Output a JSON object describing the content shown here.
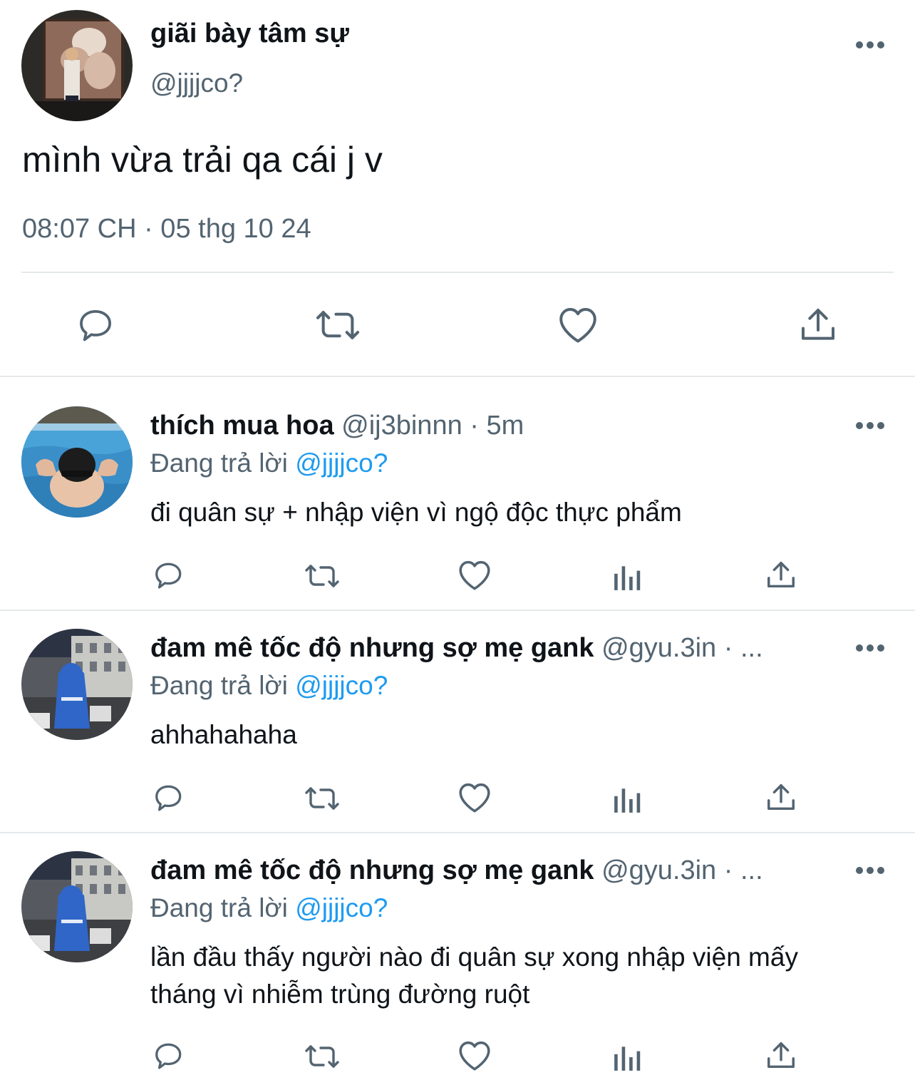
{
  "main_tweet": {
    "display_name": "giãi bày tâm sự",
    "handle": "@jjjjco?",
    "text": "mình vừa trải qa cái j v",
    "timestamp": "08:07 CH · 05 thg 10 24",
    "more_icon": "more-horizontal-icon",
    "actions": [
      "reply-icon",
      "retweet-icon",
      "like-icon",
      "share-icon"
    ]
  },
  "replies": [
    {
      "display_name": "thích mua hoa",
      "handle_time": "@ij3binnn · 5m",
      "replying_prefix": "Đang trả lời",
      "replying_to": "@jjjjco?",
      "text": "đi quân sự + nhập viện vì ngộ độc thực phẩm"
    },
    {
      "display_name": "đam mê tốc độ nhưng sợ mẹ gank",
      "handle_time": "@gyu.3in · ...",
      "replying_prefix": "Đang trả lời",
      "replying_to": "@jjjjco?",
      "text": "ahhahahaha"
    },
    {
      "display_name": "đam mê tốc độ nhưng sợ mẹ gank",
      "handle_time": "@gyu.3in · ...",
      "replying_prefix": "Đang trả lời",
      "replying_to": "@jjjjco?",
      "text": "lần đầu thấy người nào đi quân sự xong nhập viện mấy tháng vì nhiễm trùng đường ruột"
    }
  ],
  "reply_actions": [
    "reply-icon",
    "retweet-icon",
    "like-icon",
    "views-icon",
    "share-icon"
  ],
  "colors": {
    "text": "#0f1419",
    "secondary": "#536471",
    "mention": "#1d9bf0",
    "divider": "#e6e9eb"
  }
}
